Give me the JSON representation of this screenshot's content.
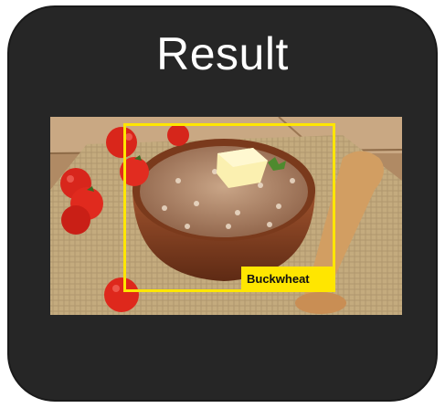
{
  "title": "Result",
  "detection": {
    "label": "Buckwheat",
    "box_color": "#ffe600"
  },
  "photo": {
    "subject": "bowl of buckwheat with butter, cherry tomatoes and wooden spoon"
  },
  "colors": {
    "card_background": "#262626",
    "title_text": "#ffffff",
    "detection_accent": "#ffe600"
  }
}
